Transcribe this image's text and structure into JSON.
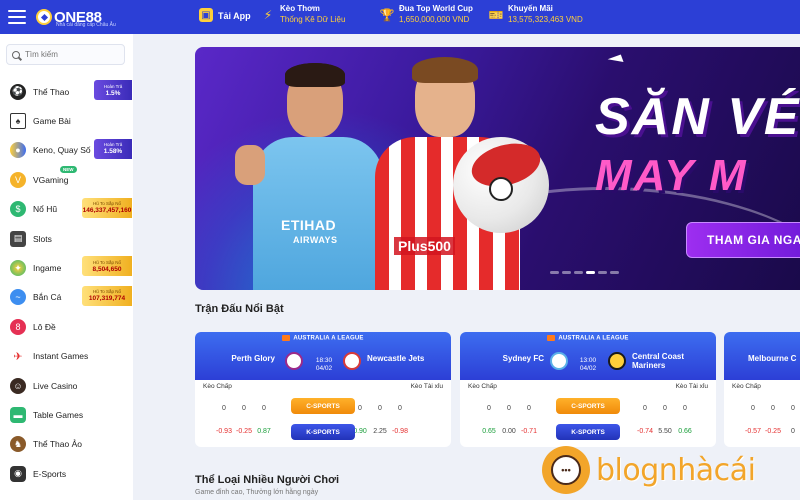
{
  "header": {
    "logo": "ONE88",
    "logo_sub": "Nhà cái đẳng cấp Châu Âu",
    "items": [
      {
        "title": "Tải App",
        "sub": ""
      },
      {
        "title": "Kèo Thơm",
        "sub": "Thống Kê Dữ Liệu"
      },
      {
        "title": "Đua Top World Cup",
        "sub": "1,650,000,000 VND"
      },
      {
        "title": "Khuyến Mãi",
        "sub": "13,575,323,463 VND"
      }
    ]
  },
  "sidebar": {
    "search_placeholder": "Tìm kiếm",
    "items": [
      {
        "label": "Thể Thao",
        "badge_title": "Hoàn Trả",
        "badge_value": "1.5%",
        "badge_type": "purple",
        "icon": "soccer-ball-icon"
      },
      {
        "label": "Game Bài",
        "icon": "cards-icon"
      },
      {
        "label": "Keno, Quay Số",
        "badge_title": "Hoàn Trả",
        "badge_value": "1.58%",
        "badge_type": "purple",
        "icon": "lottery-balls-icon"
      },
      {
        "label": "VGaming",
        "new_tag": "NEW",
        "icon": "vgaming-icon"
      },
      {
        "label": "Nổ Hũ",
        "badge_title": "Hũ To Sắp Nổ",
        "badge_value": "146,337,457,160",
        "badge_type": "gold",
        "icon": "slot-jar-icon"
      },
      {
        "label": "Slots",
        "icon": "slot-machine-icon"
      },
      {
        "label": "Ingame",
        "badge_title": "Hũ To Sắp Nổ",
        "badge_value": "8,504,650",
        "badge_type": "gold",
        "icon": "ingame-icon"
      },
      {
        "label": "Bắn Cá",
        "badge_title": "Hũ To Sắp Nổ",
        "badge_value": "107,319,774",
        "badge_type": "gold",
        "icon": "fish-icon"
      },
      {
        "label": "Lô Đề",
        "icon": "lottery-icon"
      },
      {
        "label": "Instant Games",
        "icon": "plane-icon"
      },
      {
        "label": "Live Casino",
        "icon": "dealer-icon"
      },
      {
        "label": "Table Games",
        "icon": "table-icon"
      },
      {
        "label": "Thể Thao Ảo",
        "icon": "virtual-sports-icon"
      },
      {
        "label": "E-Sports",
        "icon": "gamepad-icon"
      }
    ]
  },
  "banner": {
    "line1": "SĂN VÉ C",
    "line2": "MAY M",
    "cta": "THAM GIA NGAY",
    "jersey1": "ETIHAD",
    "jersey1_sub": "AIRWAYS",
    "jersey2": "Plus500"
  },
  "featured": {
    "title": "Trận Đấu Nổi Bật",
    "matches": [
      {
        "league": "AUSTRALIA A LEAGUE",
        "home": "Perth Glory",
        "away": "Newcastle Jets",
        "time": "18:30",
        "date": "04/02",
        "handicap_label": "Kèo Chấp",
        "ou_label": "Kèo Tài xỉu",
        "row1": [
          "0",
          "0",
          "0",
          "0",
          "0",
          "0"
        ],
        "row2": [
          "-0.93",
          "-0.25",
          "0.87",
          "0.90",
          "2.25",
          "-0.98"
        ],
        "csports": "C-SPORTS",
        "ksports": "K-SPORTS"
      },
      {
        "league": "AUSTRALIA A LEAGUE",
        "home": "Sydney FC",
        "away": "Central Coast Mariners",
        "time": "13:00",
        "date": "04/02",
        "handicap_label": "Kèo Chấp",
        "ou_label": "Kèo Tài xỉu",
        "row1": [
          "0",
          "0",
          "0",
          "0",
          "0",
          "0"
        ],
        "row2": [
          "0.65",
          "0.00",
          "-0.71",
          "-0.74",
          "5.50",
          "0.66"
        ],
        "csports": "C-SPORTS",
        "ksports": "K-SPORTS"
      },
      {
        "league": "",
        "home": "Melbourne C",
        "handicap_label": "Kèo Chấp",
        "row1": [
          "0",
          "0",
          "0"
        ],
        "row2": [
          "-0.57",
          "-0.25",
          "0"
        ]
      }
    ]
  },
  "section2": {
    "title": "Thể Loại Nhiều Người Chơi",
    "subtitle": "Game đỉnh cao, Thưởng lớn hằng ngày"
  },
  "watermark": "blognhàcái",
  "colors": {
    "header": "#2c3fd6",
    "accent_gold": "#ffcf3a",
    "cta_purple": "#8a24e0"
  }
}
